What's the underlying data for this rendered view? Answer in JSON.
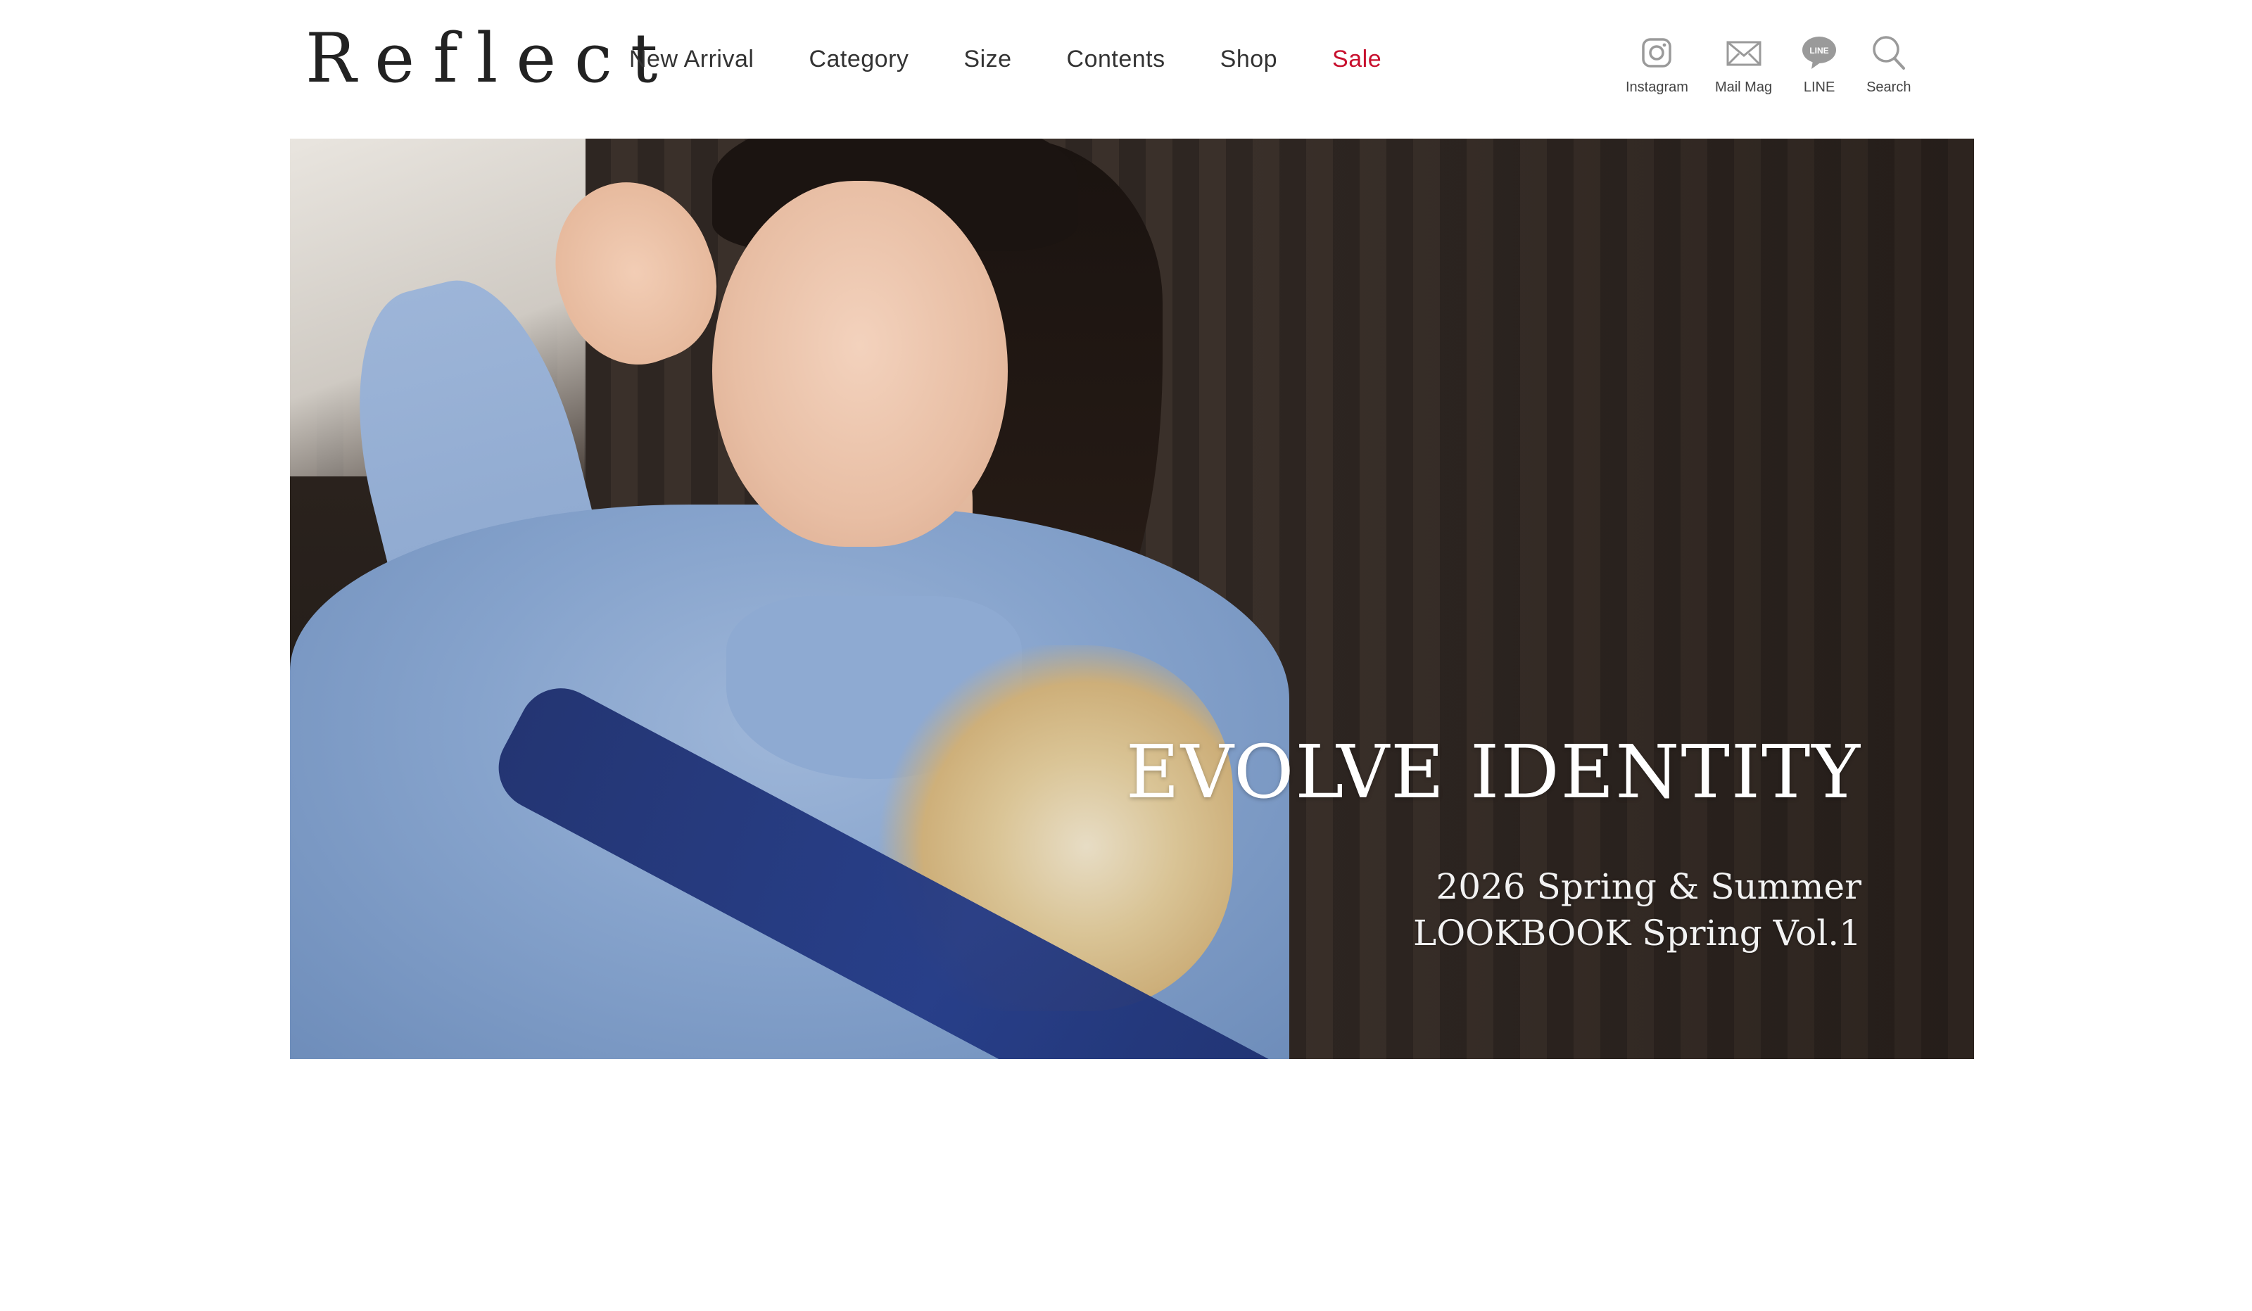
{
  "header": {
    "logo_text": "Reflect",
    "nav": [
      {
        "label": "New Arrival"
      },
      {
        "label": "Category"
      },
      {
        "label": "Size"
      },
      {
        "label": "Contents"
      },
      {
        "label": "Shop"
      },
      {
        "label": "Sale"
      }
    ],
    "icons": [
      {
        "label": "Instagram",
        "icon": "instagram-icon"
      },
      {
        "label": "Mail Mag",
        "icon": "mail-icon"
      },
      {
        "label": "LINE",
        "icon": "line-icon",
        "badge": "LINE"
      },
      {
        "label": "Search",
        "icon": "search-icon"
      }
    ]
  },
  "hero": {
    "title": "EVOLVE IDENTITY",
    "subtitle_line1": "2026 Spring & Summer",
    "subtitle_line2": "LOOKBOOK Spring Vol.1"
  },
  "colors": {
    "sale": "#c8102e",
    "text": "#333333",
    "icon": "#9a9a9a",
    "background": "#ffffff"
  }
}
